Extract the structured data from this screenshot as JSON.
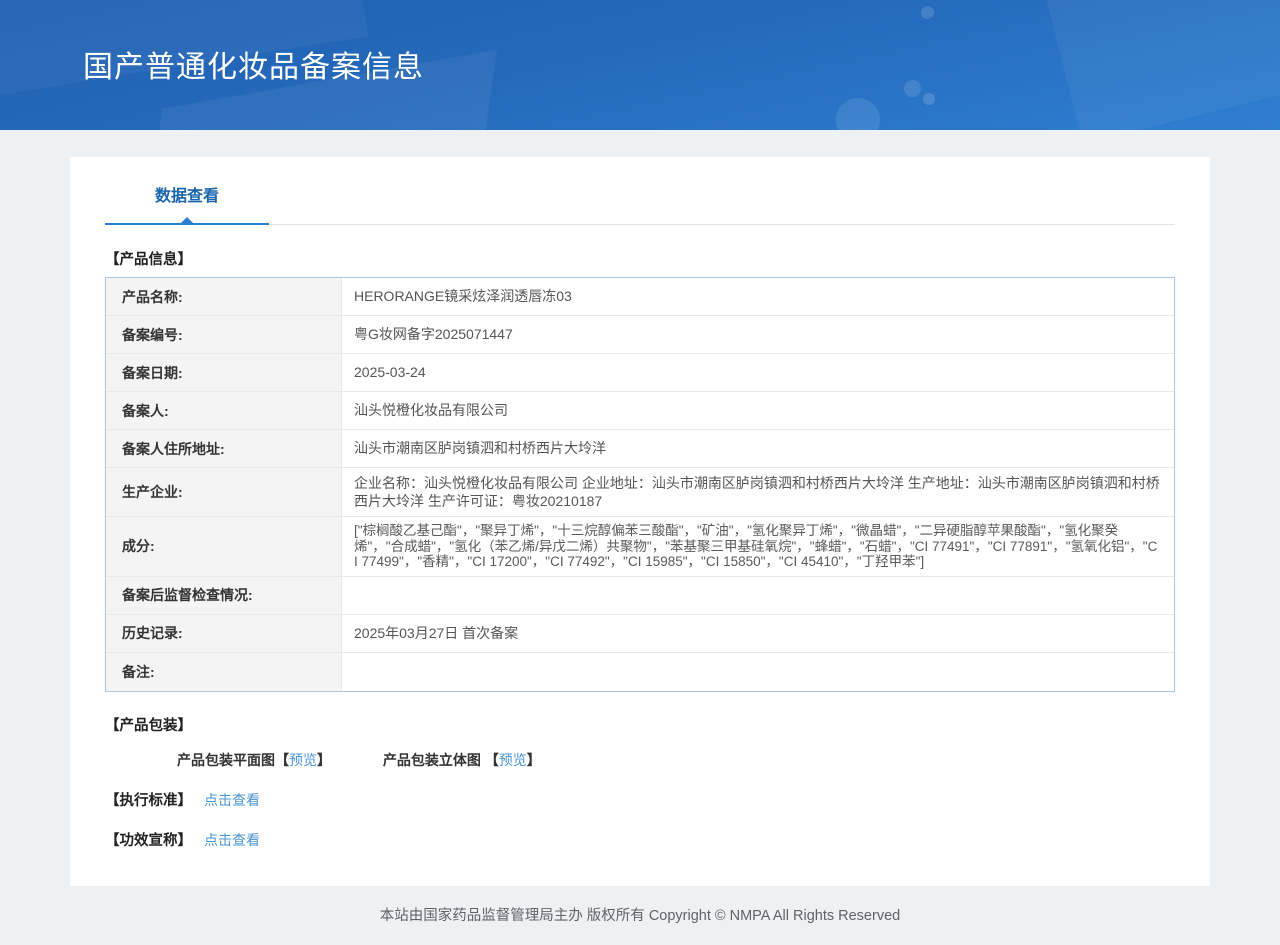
{
  "header": {
    "title": "国产普通化妆品备案信息"
  },
  "tab": {
    "label": "数据查看"
  },
  "sections": {
    "product_info_title": "【产品信息】",
    "packaging_title": "【产品包装】",
    "standard_title": "【执行标准】",
    "efficacy_title": "【功效宣称】"
  },
  "table": {
    "rows": [
      {
        "label": "产品名称:",
        "value": "HERORANGE镜采炫泽润透唇冻03"
      },
      {
        "label": "备案编号:",
        "value": "粤G妆网备字2025071447"
      },
      {
        "label": "备案日期:",
        "value": "2025-03-24"
      },
      {
        "label": "备案人:",
        "value": "汕头悦橙化妆品有限公司"
      },
      {
        "label": "备案人住所地址:",
        "value": "汕头市潮南区胪岗镇泗和村桥西片大坽洋"
      },
      {
        "label": "生产企业:",
        "value": "企业名称：汕头悦橙化妆品有限公司 企业地址：汕头市潮南区胪岗镇泗和村桥西片大坽洋 生产地址：汕头市潮南区胪岗镇泗和村桥西片大坽洋 生产许可证：粤妆20210187"
      },
      {
        "label": "成分:",
        "value": "[\"棕榈酸乙基己酯\"，\"聚异丁烯\"，\"十三烷醇偏苯三酸酯\"，\"矿油\"，\"氢化聚异丁烯\"，\"微晶蜡\"，\"二异硬脂醇苹果酸酯\"，\"氢化聚癸烯\"，\"合成蜡\"，\"氢化（苯乙烯/异戊二烯）共聚物\"，\"苯基聚三甲基硅氧烷\"，\"蜂蜡\"，\"石蜡\"，\"CI 77491\"，\"CI 77891\"，\"氢氧化铝\"，\"CI 77499\"，\"香精\"，\"CI 17200\"，\"CI 77492\"，\"CI 15985\"，\"CI 15850\"，\"CI 45410\"，\"丁羟甲苯\"]"
      },
      {
        "label": "备案后监督检查情况:",
        "value": ""
      },
      {
        "label": "历史记录:",
        "value": "2025年03月27日 首次备案"
      },
      {
        "label": "备注:",
        "value": ""
      }
    ]
  },
  "packaging": {
    "flat_label": "产品包装平面图",
    "stereo_label": "产品包装立体图 ",
    "bracket_open": "【",
    "bracket_close": "】",
    "preview_label": "预览"
  },
  "links": {
    "view_label": "点击查看"
  },
  "footer": {
    "copyright": "本站由国家药品监督管理局主办 版权所有 Copyright © NMPA All Rights Reserved"
  },
  "colors": {
    "banner_top": "#2061b2",
    "banner_bottom": "#2e7ed2",
    "tab_accent": "#2b7fd0",
    "tab_text": "#1a66ad",
    "link": "#4a94d8",
    "table_border": "#a9c7e2",
    "label_bg": "#f4f4f4",
    "page_bg": "#eef1f4"
  }
}
